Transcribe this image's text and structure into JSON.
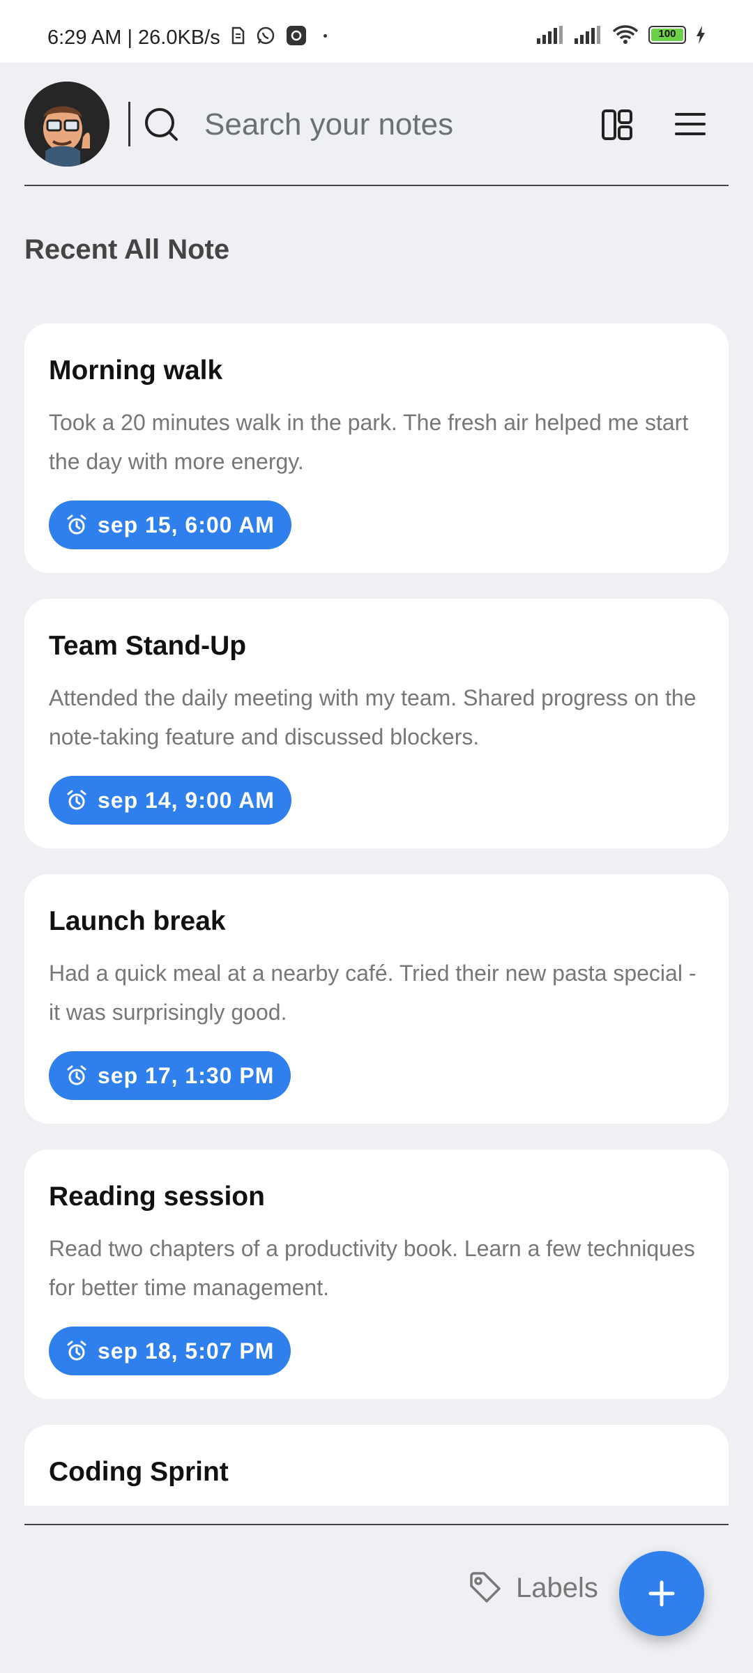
{
  "status_bar": {
    "time_speed": "6:29 AM | 26.0KB/s",
    "battery": "100"
  },
  "header": {
    "search_placeholder": "Search your notes"
  },
  "section_title": "Recent All Note",
  "notes": [
    {
      "title": "Morning walk",
      "body": "Took a 20 minutes walk in the park. The fresh air helped me start the day with more energy.",
      "reminder": "sep 15, 6:00 AM"
    },
    {
      "title": "Team Stand-Up",
      "body": "Attended the daily meeting with my team. Shared progress on the note-taking feature and discussed blockers.",
      "reminder": "sep 14, 9:00 AM"
    },
    {
      "title": "Launch break",
      "body": "Had a quick meal at a nearby café. Tried their new pasta special - it was surprisingly good.",
      "reminder": "sep 17, 1:30 PM"
    },
    {
      "title": "Reading session",
      "body": "Read two chapters of a productivity book. Learn a few techniques for better time management.",
      "reminder": "sep 18, 5:07 PM"
    },
    {
      "title": "Coding Sprint",
      "body": "",
      "reminder": ""
    }
  ],
  "bottom_bar": {
    "labels_label": "Labels"
  },
  "colors": {
    "accent": "#2f80ed",
    "background": "#eef0f4"
  }
}
